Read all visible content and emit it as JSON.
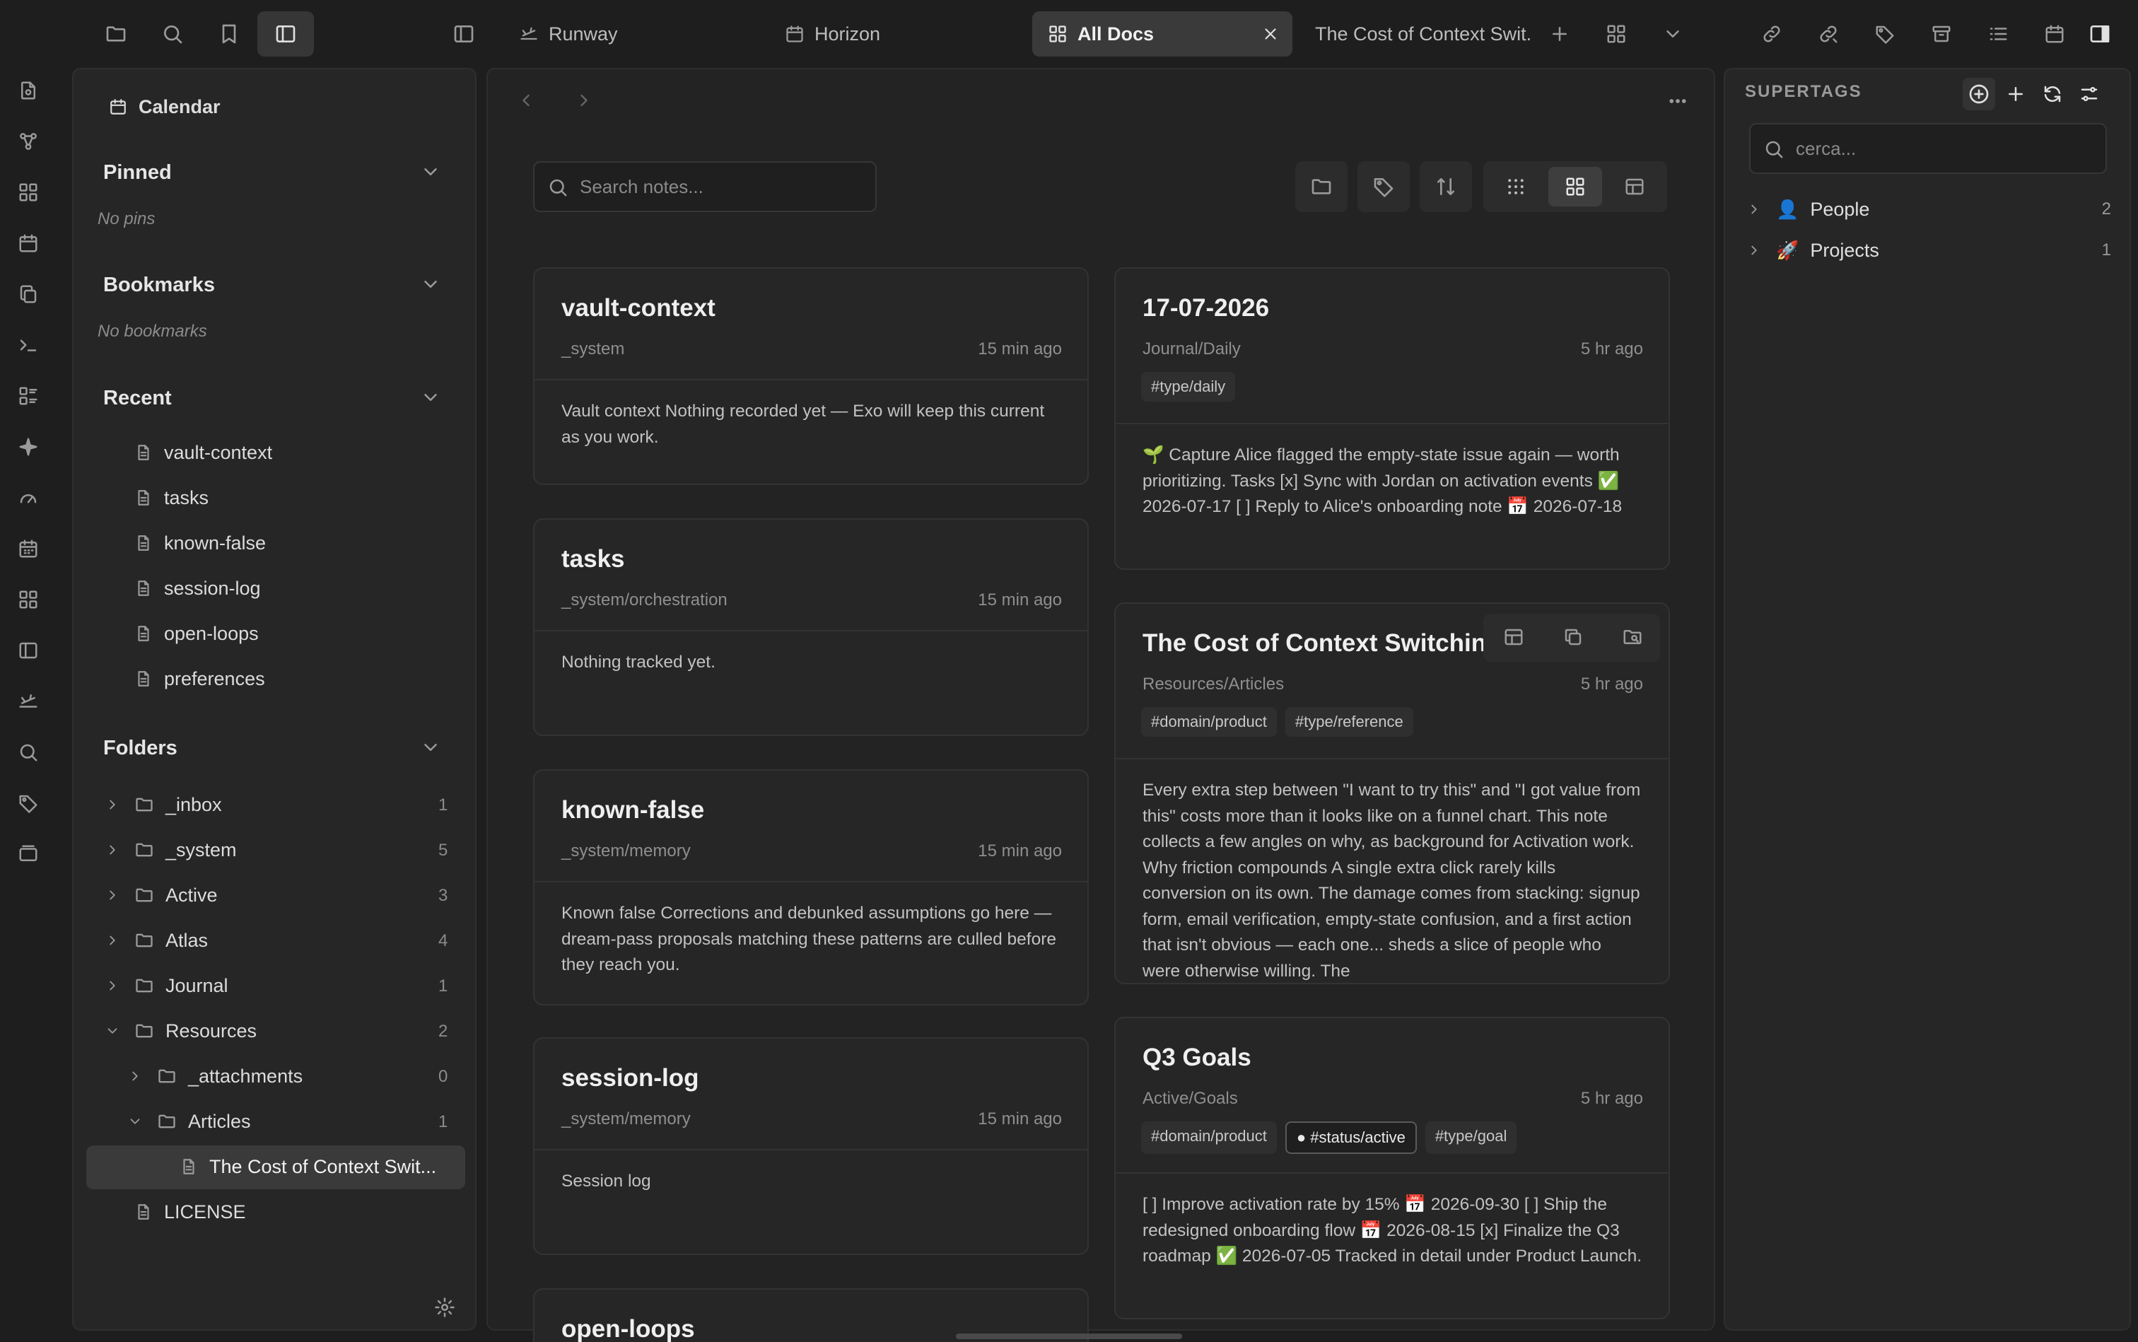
{
  "titlebar": {
    "tabs": [
      {
        "label": "Runway",
        "icon": "runway-icon"
      },
      {
        "label": "Horizon",
        "icon": "calendar-icon"
      },
      {
        "label": "All Docs",
        "icon": "grid-icon",
        "active": true
      },
      {
        "label": "The Cost of Context Swit.",
        "icon": ""
      }
    ]
  },
  "sidebar": {
    "top_item": "Calendar",
    "pinned": {
      "title": "Pinned",
      "empty": "No pins"
    },
    "bookmarks": {
      "title": "Bookmarks",
      "empty": "No bookmarks"
    },
    "recent": {
      "title": "Recent",
      "items": [
        "vault-context",
        "tasks",
        "known-false",
        "session-log",
        "open-loops",
        "preferences"
      ]
    },
    "folders": {
      "title": "Folders",
      "items": [
        {
          "name": "_inbox",
          "count": "1"
        },
        {
          "name": "_system",
          "count": "5"
        },
        {
          "name": "Active",
          "count": "3"
        },
        {
          "name": "Atlas",
          "count": "4"
        },
        {
          "name": "Journal",
          "count": "1"
        },
        {
          "name": "Resources",
          "count": "2"
        },
        {
          "name": "_attachments",
          "count": "0"
        },
        {
          "name": "Articles",
          "count": "1"
        },
        {
          "name": "The Cost of Context Swit...",
          "count": ""
        },
        {
          "name": "LICENSE",
          "count": ""
        }
      ]
    }
  },
  "main": {
    "search_placeholder": "Search notes...",
    "cards_left": [
      {
        "title": "vault-context",
        "path": "_system",
        "time": "15 min ago",
        "body": "Vault context Nothing recorded yet — Exo will keep this current as you work."
      },
      {
        "title": "tasks",
        "path": "_system/orchestration",
        "time": "15 min ago",
        "body": "Nothing tracked yet."
      },
      {
        "title": "known-false",
        "path": "_system/memory",
        "time": "15 min ago",
        "body": "Known false Corrections and debunked assumptions go here — dream-pass proposals matching these patterns are culled before they reach you."
      },
      {
        "title": "session-log",
        "path": "_system/memory",
        "time": "15 min ago",
        "body": "Session log"
      },
      {
        "title": "open-loops",
        "path": "",
        "time": "",
        "body": ""
      }
    ],
    "cards_right": [
      {
        "title": "17-07-2026",
        "path": "Journal/Daily",
        "time": "5 hr ago",
        "tags": [
          "#type/daily"
        ],
        "body": "🌱 Capture Alice flagged the empty-state issue again — worth prioritizing. Tasks [x] Sync with Jordan on activation events ✅ 2026-07-17 [ ] Reply to Alice's onboarding note 📅 2026-07-18"
      },
      {
        "title": "The Cost of Context Switching",
        "path": "Resources/Articles",
        "time": "5 hr ago",
        "tags": [
          "#domain/product",
          "#type/reference"
        ],
        "body": "Every extra step between \"I want to try this\" and \"I got value from this\" costs more than it looks like on a funnel chart. This note collects a few angles on why, as background for Activation work. Why friction compounds A single extra click rarely kills conversion on its own. The damage comes from stacking: signup form, email verification, empty-state confusion, and a first action that isn't obvious — each one... sheds a slice of people who were otherwise willing. The"
      },
      {
        "title": "Q3 Goals",
        "path": "Active/Goals",
        "time": "5 hr ago",
        "tags": [
          "#domain/product",
          "#status/active",
          "#type/goal"
        ],
        "body": "[ ] Improve activation rate by 15% 📅 2026-09-30 [ ] Ship the redesigned onboarding flow 📅 2026-08-15 [x] Finalize the Q3 roadmap ✅ 2026-07-05 Tracked in detail under Product Launch."
      }
    ]
  },
  "right_panel": {
    "title": "SUPERTAGS",
    "search_placeholder": "cerca...",
    "items": [
      {
        "emoji": "👤",
        "label": "People",
        "count": "2"
      },
      {
        "emoji": "🚀",
        "label": "Projects",
        "count": "1"
      }
    ]
  }
}
